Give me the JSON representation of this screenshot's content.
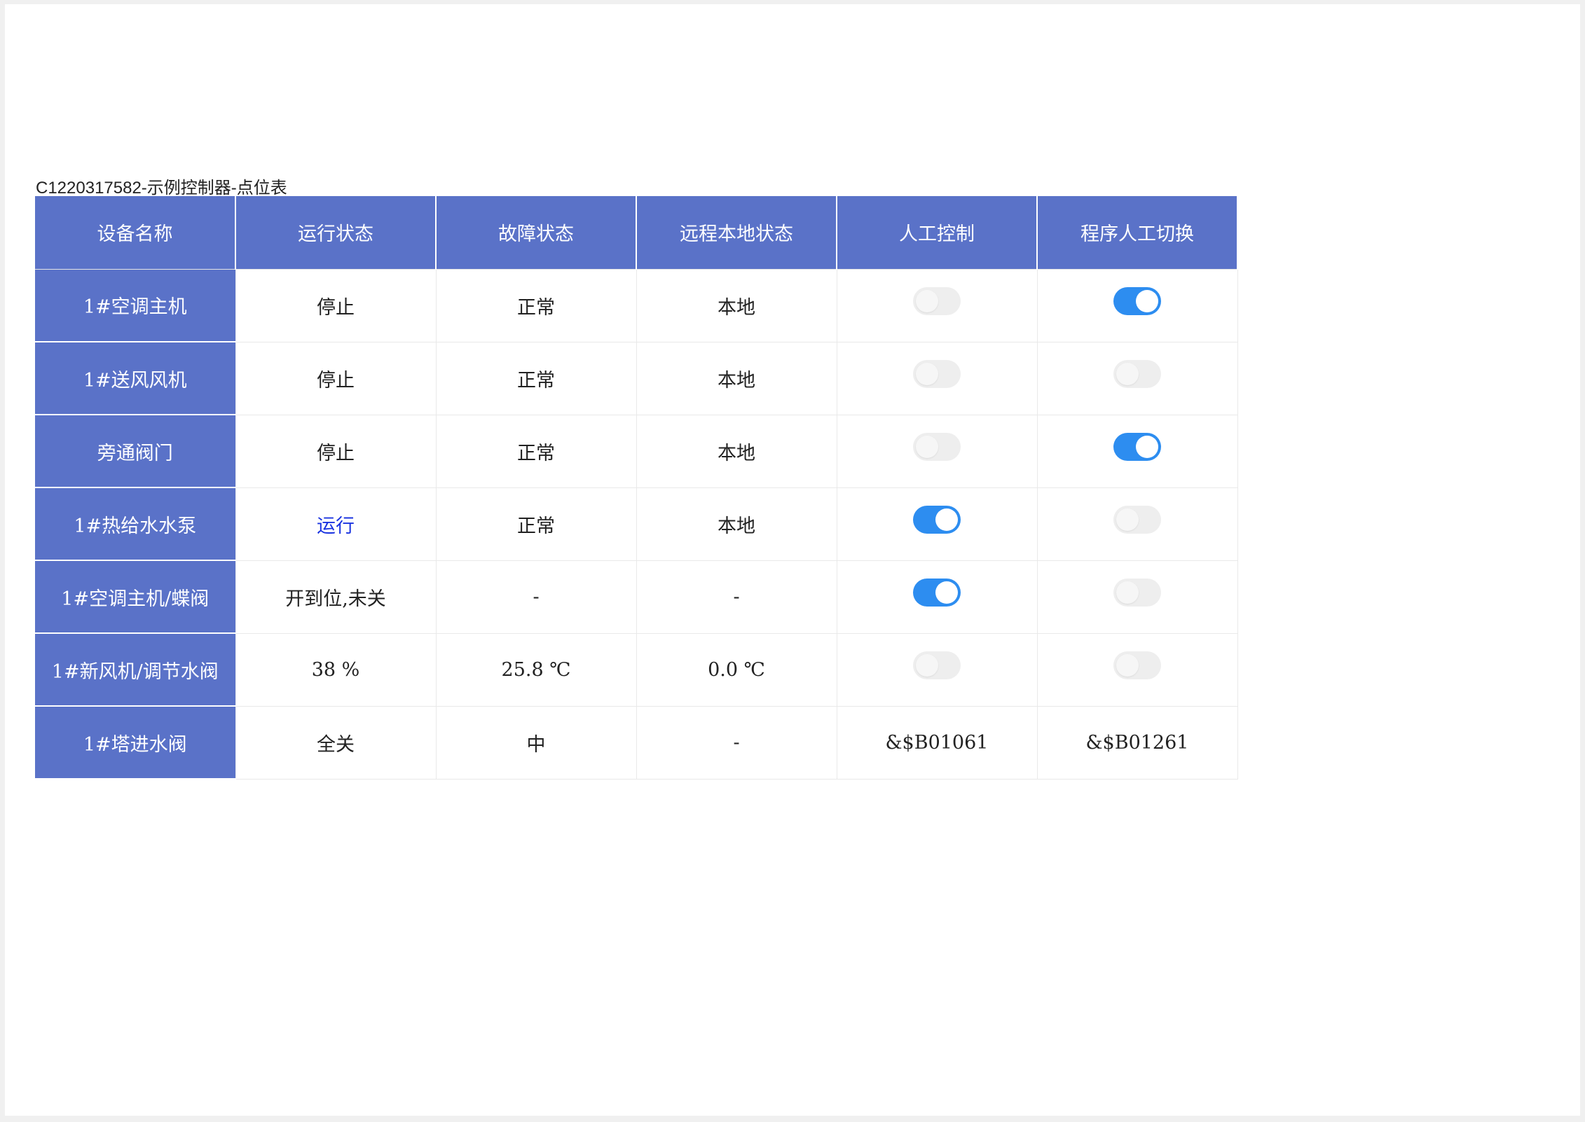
{
  "caption": "C1220317582-示例控制器-点位表",
  "colors": {
    "header_bg": "#5a72c8",
    "toggle_on": "#2d8df0",
    "toggle_off": "#eeeeee",
    "running_text": "#1a33e0"
  },
  "headers": [
    "设备名称",
    "运行状态",
    "故障状态",
    "远程本地状态",
    "人工控制",
    "程序人工切换"
  ],
  "rows": [
    {
      "name": "1#空调主机",
      "run": "停止",
      "fault": "正常",
      "remote": "本地",
      "manual": false,
      "program": true
    },
    {
      "name": "1#送风风机",
      "run": "停止",
      "fault": "正常",
      "remote": "本地",
      "manual": false,
      "program": false
    },
    {
      "name": "旁通阀门",
      "run": "停止",
      "fault": "正常",
      "remote": "本地",
      "manual": false,
      "program": true
    },
    {
      "name": "1#热给水水泵",
      "run": "运行",
      "fault": "正常",
      "remote": "本地",
      "manual": true,
      "program": false
    },
    {
      "name": "1#空调主机/蝶阀",
      "run": "开到位,未关",
      "fault": "-",
      "remote": "-",
      "manual": true,
      "program": false
    },
    {
      "name": "1#新风机/调节水阀",
      "run": "38 %",
      "fault": "25.8 ℃",
      "remote": "0.0 ℃",
      "manual": false,
      "program": false
    },
    {
      "name": "1#塔进水阀",
      "run": "全关",
      "fault": "中",
      "remote": "-",
      "manual": "&$B01061",
      "program": "&$B01261"
    }
  ]
}
